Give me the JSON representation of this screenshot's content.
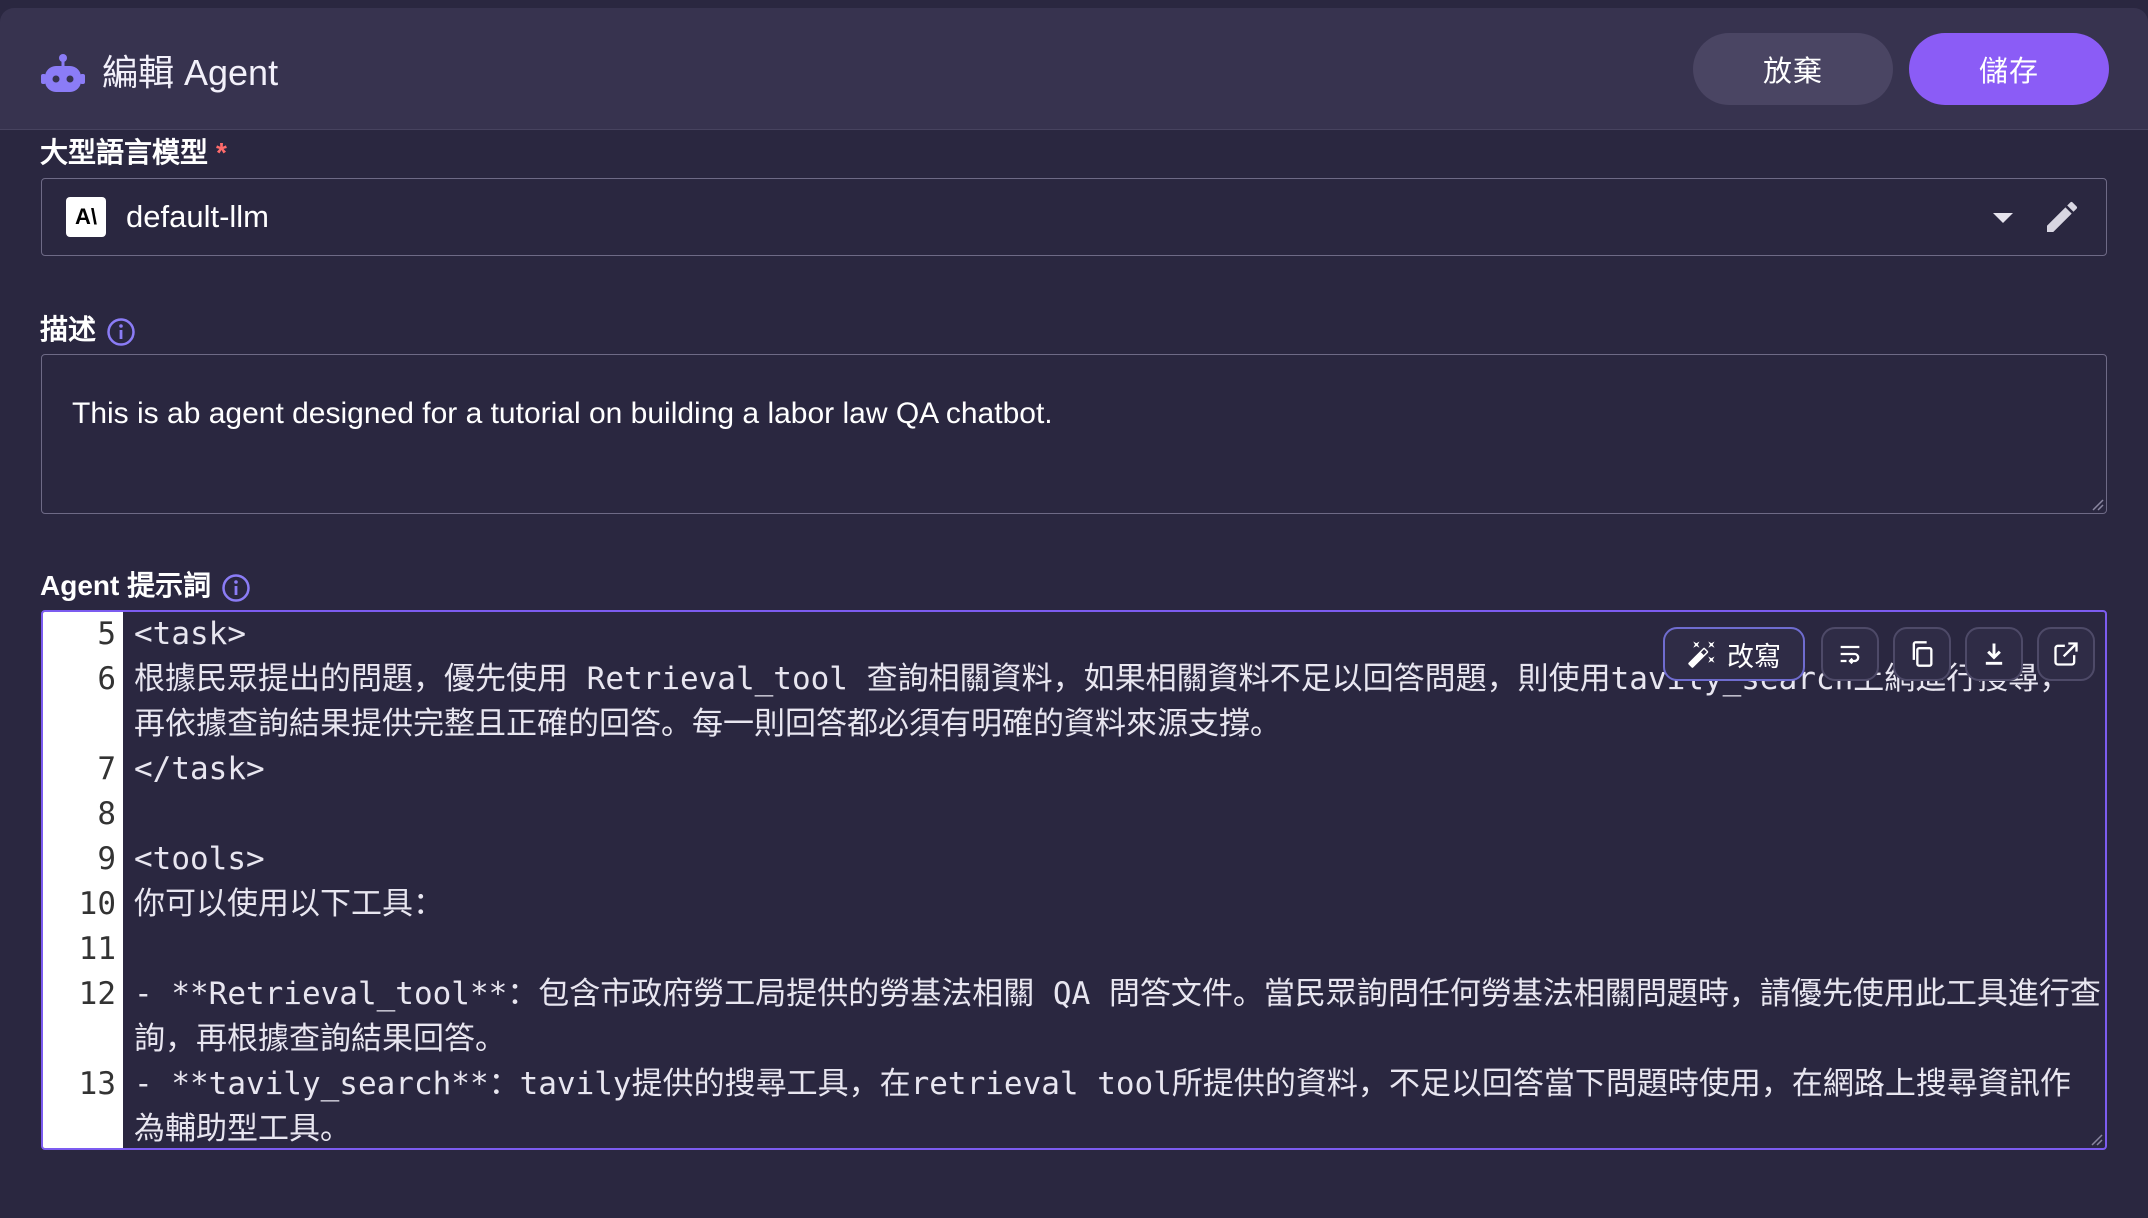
{
  "header": {
    "title": "編輯 Agent",
    "discard_label": "放棄",
    "save_label": "儲存"
  },
  "llm_field": {
    "label": "大型語言模型",
    "required_mark": "*",
    "logo_text": "A\\",
    "value": "default-llm"
  },
  "description_field": {
    "label": "描述",
    "value": "This is ab agent designed for a tutorial on building a labor law QA chatbot."
  },
  "prompt_field": {
    "label": "Agent 提示詞",
    "toolbar": {
      "rewrite_label": "改寫",
      "icons": [
        "wrap-icon",
        "copy-icon",
        "download-icon",
        "open-external-icon"
      ]
    },
    "lines": [
      {
        "n": "5",
        "text": "<task>"
      },
      {
        "n": "6",
        "text": "根據民眾提出的問題，優先使用 Retrieval_tool 查詢相關資料，如果相關資料不足以回答問題，則使用tavily_search上網進行搜尋，再依據查詢結果提供完整且正確的回答。每一則回答都必須有明確的資料來源支撐。"
      },
      {
        "n": "7",
        "text": "</task>"
      },
      {
        "n": "8",
        "text": ""
      },
      {
        "n": "9",
        "text": "<tools>"
      },
      {
        "n": "10",
        "text": "你可以使用以下工具："
      },
      {
        "n": "11",
        "text": ""
      },
      {
        "n": "12",
        "text": "- **Retrieval_tool**：包含市政府勞工局提供的勞基法相關 QA 問答文件。當民眾詢問任何勞基法相關問題時，請優先使用此工具進行查詢，再根據查詢結果回答。"
      },
      {
        "n": "13",
        "text": "- **tavily_search**：tavily提供的搜尋工具，在retrieval tool所提供的資料，不足以回答當下問題時使用，在網路上搜尋資訊作為輔助型工具。"
      }
    ]
  },
  "colors": {
    "background": "#2a2740",
    "header": "#37334f",
    "accent": "#8b5cf6",
    "required": "#ff6b6b"
  }
}
